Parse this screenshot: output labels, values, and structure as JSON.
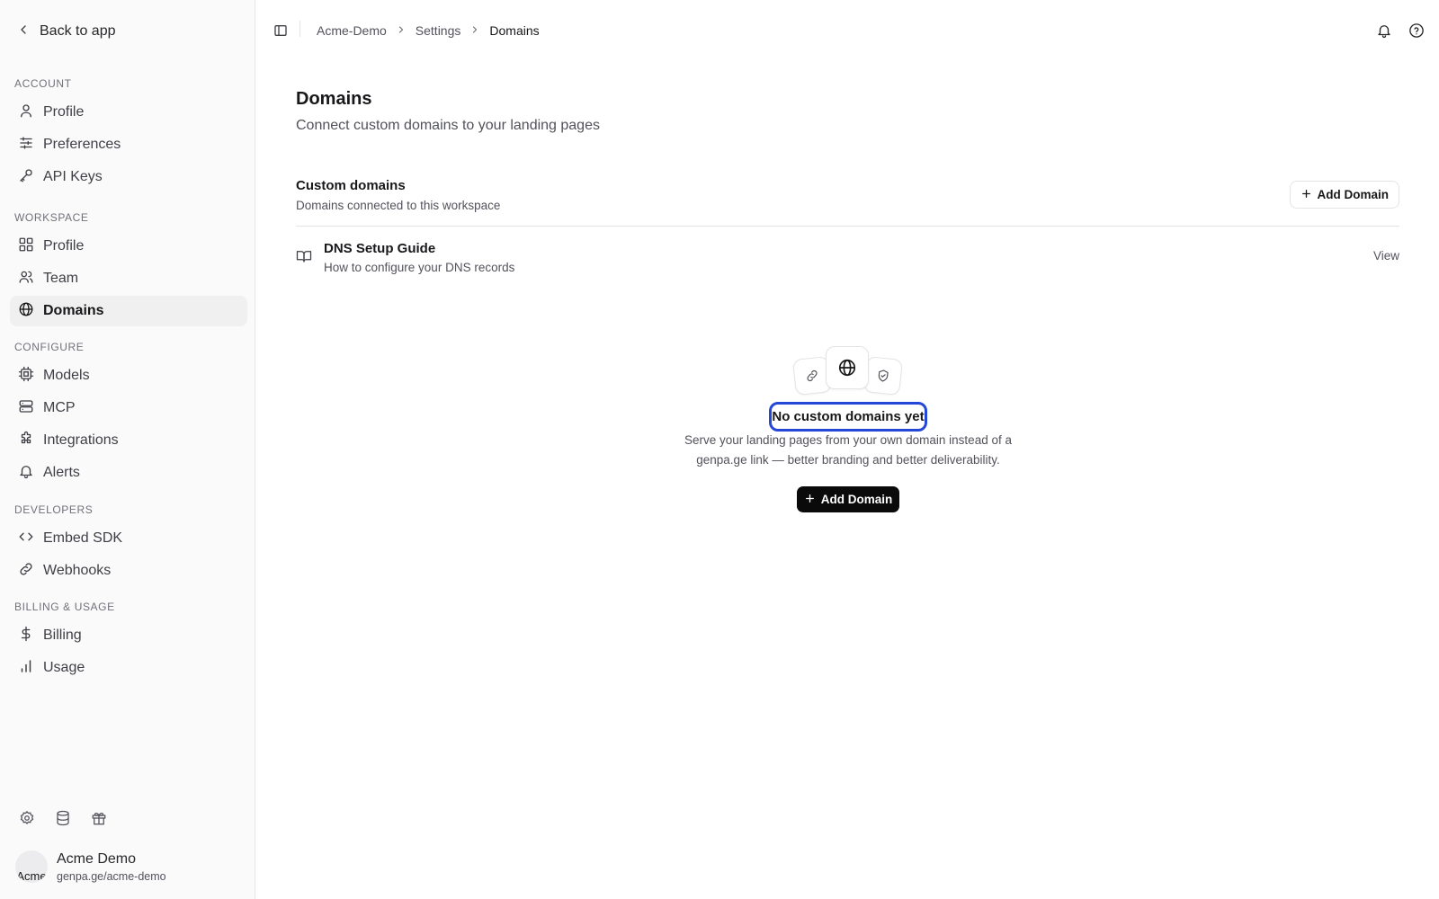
{
  "sidebar": {
    "back_label": "Back to app",
    "groups": [
      {
        "label": "ACCOUNT",
        "items": [
          {
            "label": "Profile",
            "icon": "user-icon"
          },
          {
            "label": "Preferences",
            "icon": "sliders-icon"
          },
          {
            "label": "API Keys",
            "icon": "key-icon"
          }
        ]
      },
      {
        "label": "WORKSPACE",
        "items": [
          {
            "label": "Profile",
            "icon": "grid-icon"
          },
          {
            "label": "Team",
            "icon": "users-icon"
          },
          {
            "label": "Domains",
            "icon": "globe-icon",
            "active": true
          }
        ]
      },
      {
        "label": "CONFIGURE",
        "items": [
          {
            "label": "Models",
            "icon": "cpu-icon"
          },
          {
            "label": "MCP",
            "icon": "server-icon"
          },
          {
            "label": "Integrations",
            "icon": "puzzle-icon"
          },
          {
            "label": "Alerts",
            "icon": "bell-icon"
          }
        ]
      },
      {
        "label": "DEVELOPERS",
        "items": [
          {
            "label": "Embed SDK",
            "icon": "code-icon"
          },
          {
            "label": "Webhooks",
            "icon": "link-icon"
          }
        ]
      },
      {
        "label": "BILLING & USAGE",
        "items": [
          {
            "label": "Billing",
            "icon": "dollar-icon"
          },
          {
            "label": "Usage",
            "icon": "bar-chart-icon"
          }
        ]
      }
    ],
    "footer_icons": [
      "settings-icon",
      "database-icon",
      "gift-icon"
    ],
    "user": {
      "avatar_alt": "Acme",
      "name": "Acme Demo",
      "url": "genpa.ge/acme-demo"
    }
  },
  "topbar": {
    "breadcrumbs": [
      "Acme-Demo",
      "Settings",
      "Domains"
    ],
    "icons": [
      "bell-icon",
      "help-icon"
    ]
  },
  "main": {
    "title": "Domains",
    "subtitle": "Connect custom domains to your landing pages",
    "section_title": "Custom domains",
    "section_subtitle": "Domains connected to this workspace",
    "add_button": "Add Domain",
    "guide": {
      "title": "DNS Setup Guide",
      "subtitle": "How to configure your DNS records",
      "action": "View",
      "icon": "book-icon"
    },
    "empty": {
      "icons": [
        "link-icon",
        "globe-icon",
        "shield-check-icon"
      ],
      "title": "No custom domains yet",
      "description": "Serve your landing pages from your own domain instead of a genpa.ge link — better branding and better deliverability.",
      "button": "Add Domain"
    }
  },
  "colors": {
    "accent_outline": "#2547d8",
    "primary_button": "#0a0a0a",
    "sidebar_bg": "#fafafa",
    "active_item_bg": "#f0f0f1"
  }
}
